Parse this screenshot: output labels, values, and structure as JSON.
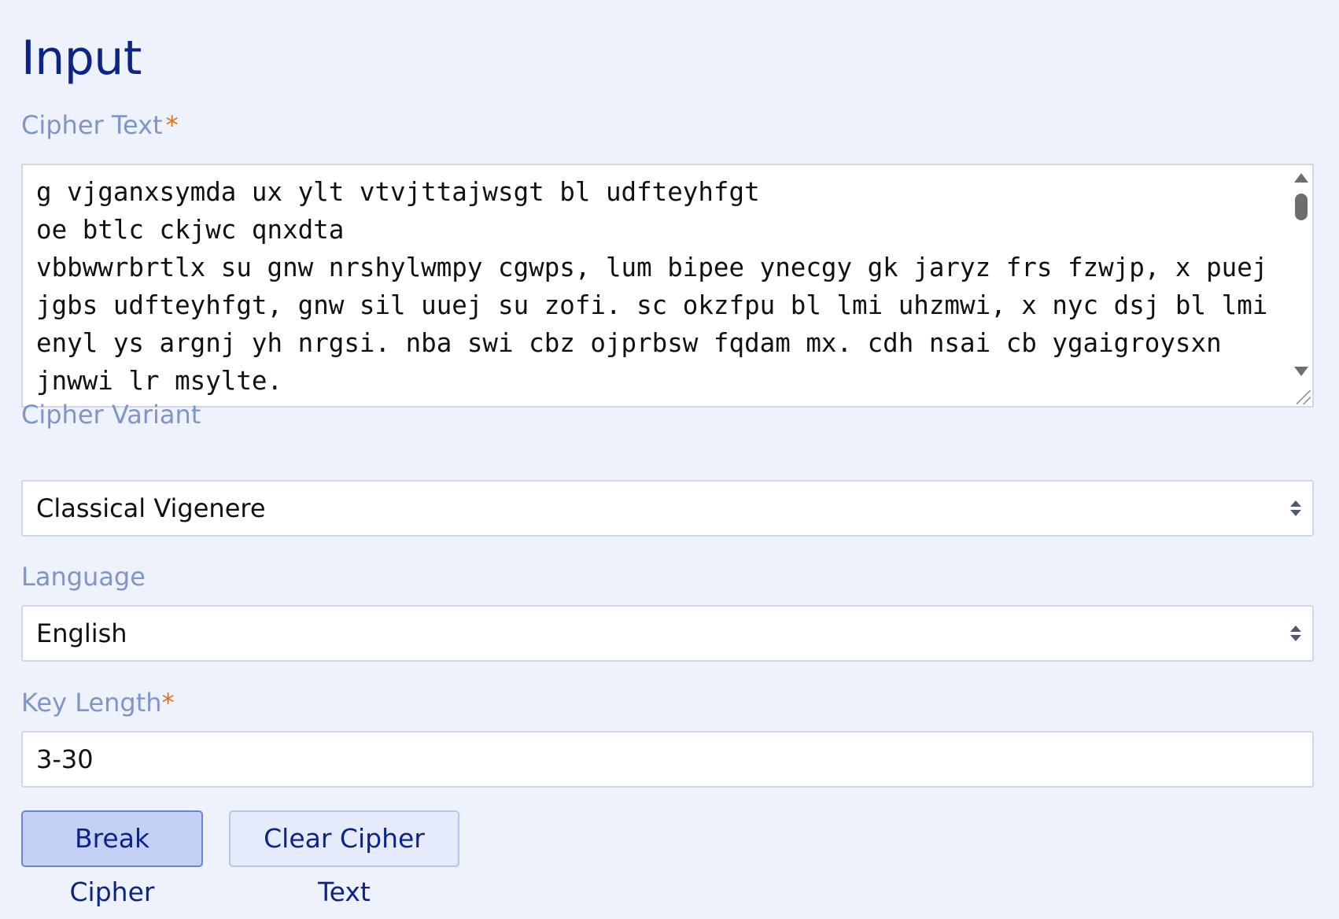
{
  "section": {
    "title": "Input"
  },
  "cipher_text": {
    "label": "Cipher Text",
    "required_mark": "*",
    "value": "g vjganxsymda ux ylt vtvjttajwsgt bl udfteyhfgt\noe btlc ckjwc qnxdta\nvbbwwrbrtlx su gnw nrshylwmpy cgwps, lum bipee ynecgy gk jaryz frs fzwjp, x puej jgbs udfteyhfgt, gnw sil uuej su zofi. sc okzfpu bl lmi uhzmwi, x nyc dsj bl lmi enyl ys argnj yh nrgsi. nba swi cbz ojprbsw fqdam mx. cdh nsai cb ygaigroysxn jnwwi lr msylte."
  },
  "cipher_variant": {
    "label": "Cipher Variant",
    "selected": "Classical Vigenere"
  },
  "language": {
    "label": "Language",
    "selected": "English"
  },
  "key_length": {
    "label": "Key Length",
    "required_mark": "*",
    "value": "3-30"
  },
  "buttons": {
    "break": "Break Cipher",
    "clear": "Clear Cipher Text"
  },
  "colors": {
    "background": "#eef2fd",
    "title": "#0d2487",
    "label": "#8095c7",
    "required": "#e0701f",
    "primary_button_bg": "#c5d0f5",
    "primary_button_border": "#6a85d8"
  },
  "icons": {
    "scroll_up": "triangle-up-icon",
    "scroll_down": "triangle-down-icon",
    "select_arrows": "up-down-caret-icon",
    "resize": "resize-grip-icon"
  }
}
